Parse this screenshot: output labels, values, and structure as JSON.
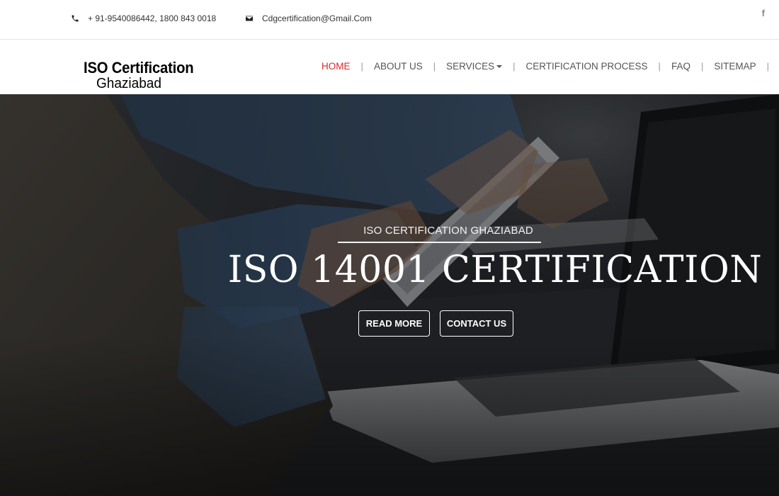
{
  "topbar": {
    "phone": "+ 91-9540086442, 1800 843 0018",
    "email": "Cdgcertification@Gmail.Com",
    "social": "f"
  },
  "logo": {
    "line1": "ISO Certification",
    "line2": "Ghaziabad"
  },
  "nav": {
    "items": [
      {
        "label": "HOME",
        "active": true
      },
      {
        "label": "ABOUT US"
      },
      {
        "label": "SERVICES",
        "dropdown": true
      },
      {
        "label": "CERTIFICATION PROCESS"
      },
      {
        "label": "FAQ"
      },
      {
        "label": "SITEMAP"
      }
    ],
    "separator": "|"
  },
  "hero": {
    "subtitle": "ISO CERTIFICATION GHAZIABAD",
    "title": "ISO 14001 CERTIFICATION",
    "read_more": "READ MORE",
    "contact_us": "CONTACT US"
  },
  "colors": {
    "accent": "#d52b2b",
    "nav_text": "#555555",
    "hero_text": "#ffffff"
  }
}
